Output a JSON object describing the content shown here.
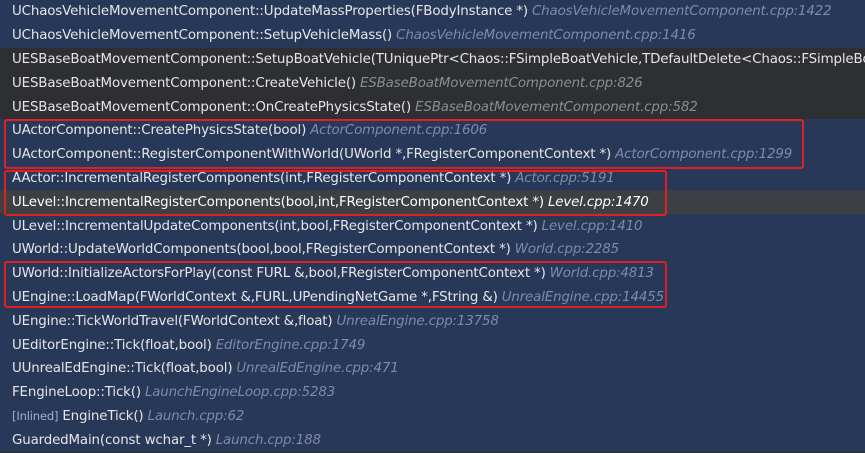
{
  "frames": [
    {
      "fn": "UChaosVehicleMovementComponent::UpdateMassProperties(FBodyInstance *)",
      "loc": "ChaosVehicleMovementComponent.cpp:1422",
      "style": "blue"
    },
    {
      "fn": "UChaosVehicleMovementComponent::SetupVehicleMass()",
      "loc": "ChaosVehicleMovementComponent.cpp:1416",
      "style": "blue"
    },
    {
      "fn": "UESBaseBoatMovementComponent::SetupBoatVehicle(TUniquePtr<Chaos::FSimpleBoatVehicle,TDefaultDelete<Chaos::FSimpleBoatVe",
      "loc": "",
      "style": "gray"
    },
    {
      "fn": "UESBaseBoatMovementComponent::CreateVehicle()",
      "loc": "ESBaseBoatMovementComponent.cpp:826",
      "style": "gray"
    },
    {
      "fn": "UESBaseBoatMovementComponent::OnCreatePhysicsState()",
      "loc": "ESBaseBoatMovementComponent.cpp:582",
      "style": "gray"
    },
    {
      "fn": "UActorComponent::CreatePhysicsState(bool)",
      "loc": "ActorComponent.cpp:1606",
      "style": "blue"
    },
    {
      "fn": "UActorComponent::RegisterComponentWithWorld(UWorld *,FRegisterComponentContext *)",
      "loc": "ActorComponent.cpp:1299",
      "style": "blue"
    },
    {
      "fn": "AActor::IncrementalRegisterComponents(int,FRegisterComponentContext *)",
      "loc": "Actor.cpp:5191",
      "style": "blue"
    },
    {
      "fn": "ULevel::IncrementalRegisterComponents(bool,int,FRegisterComponentContext *)",
      "loc": "Level.cpp:1470",
      "style": "sel"
    },
    {
      "fn": "ULevel::IncrementalUpdateComponents(int,bool,FRegisterComponentContext *)",
      "loc": "Level.cpp:1410",
      "style": "blue"
    },
    {
      "fn": "UWorld::UpdateWorldComponents(bool,bool,FRegisterComponentContext *)",
      "loc": "World.cpp:2285",
      "style": "blue"
    },
    {
      "fn": "UWorld::InitializeActorsForPlay(const FURL &,bool,FRegisterComponentContext *)",
      "loc": "World.cpp:4813",
      "style": "blue"
    },
    {
      "fn": "UEngine::LoadMap(FWorldContext &,FURL,UPendingNetGame *,FString &)",
      "loc": "UnrealEngine.cpp:14455",
      "style": "blue"
    },
    {
      "fn": "UEngine::TickWorldTravel(FWorldContext &,float)",
      "loc": "UnrealEngine.cpp:13758",
      "style": "blue"
    },
    {
      "fn": "UEditorEngine::Tick(float,bool)",
      "loc": "EditorEngine.cpp:1749",
      "style": "blue"
    },
    {
      "fn": "UUnrealEdEngine::Tick(float,bool)",
      "loc": "UnrealEdEngine.cpp:471",
      "style": "blue"
    },
    {
      "fn": "FEngineLoop::Tick()",
      "loc": "LaunchEngineLoop.cpp:5283",
      "style": "blue"
    },
    {
      "tag": "[Inlined]",
      "fn": "EngineTick()",
      "loc": "Launch.cpp:62",
      "style": "blue"
    },
    {
      "fn": "GuardedMain(const wchar_t *)",
      "loc": "Launch.cpp:188",
      "style": "blue"
    }
  ],
  "highlight_color": "#e02020"
}
